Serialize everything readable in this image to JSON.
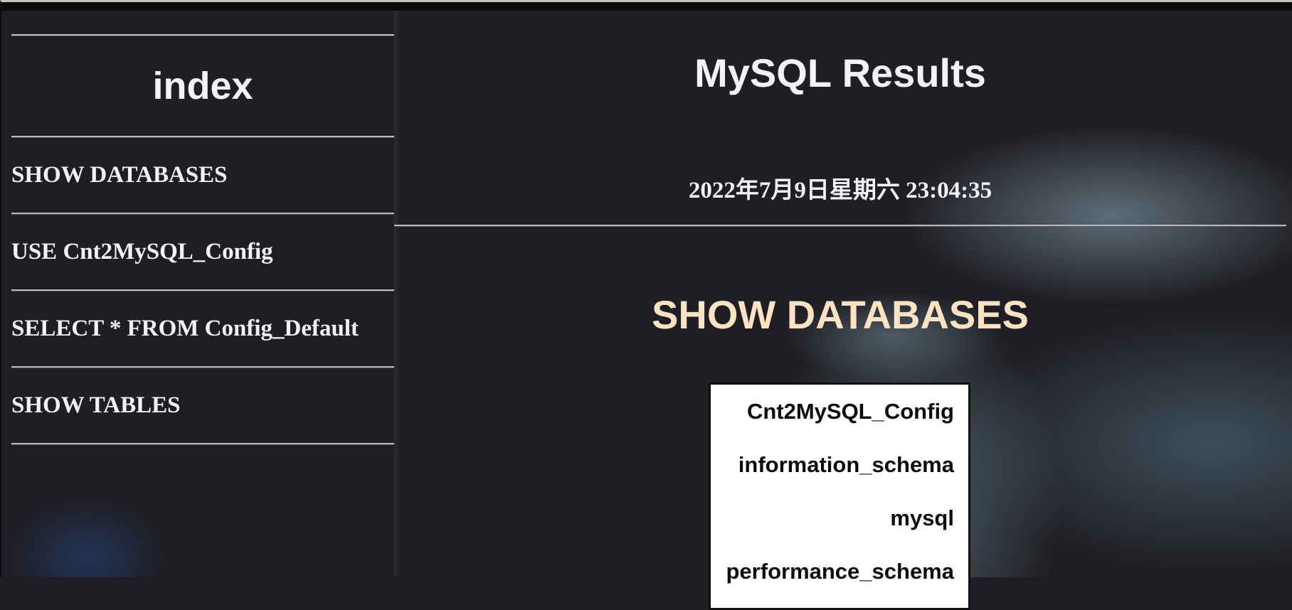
{
  "sidebar": {
    "title": "index",
    "items": [
      {
        "label": "SHOW DATABASES"
      },
      {
        "label": "USE Cnt2MySQL_Config"
      },
      {
        "label": "SELECT * FROM Config_Default"
      },
      {
        "label": "SHOW TABLES"
      }
    ]
  },
  "main": {
    "title": "MySQL Results",
    "timestamp": "2022年7月9日星期六 23:04:35",
    "query_title": "SHOW DATABASES",
    "results": [
      "Cnt2MySQL_Config",
      "information_schema",
      "mysql",
      "performance_schema"
    ]
  },
  "colors": {
    "background": "#1f1e24",
    "text": "#f4f4f6",
    "query_title": "#fde3c4",
    "table_bg": "#ffffff"
  }
}
